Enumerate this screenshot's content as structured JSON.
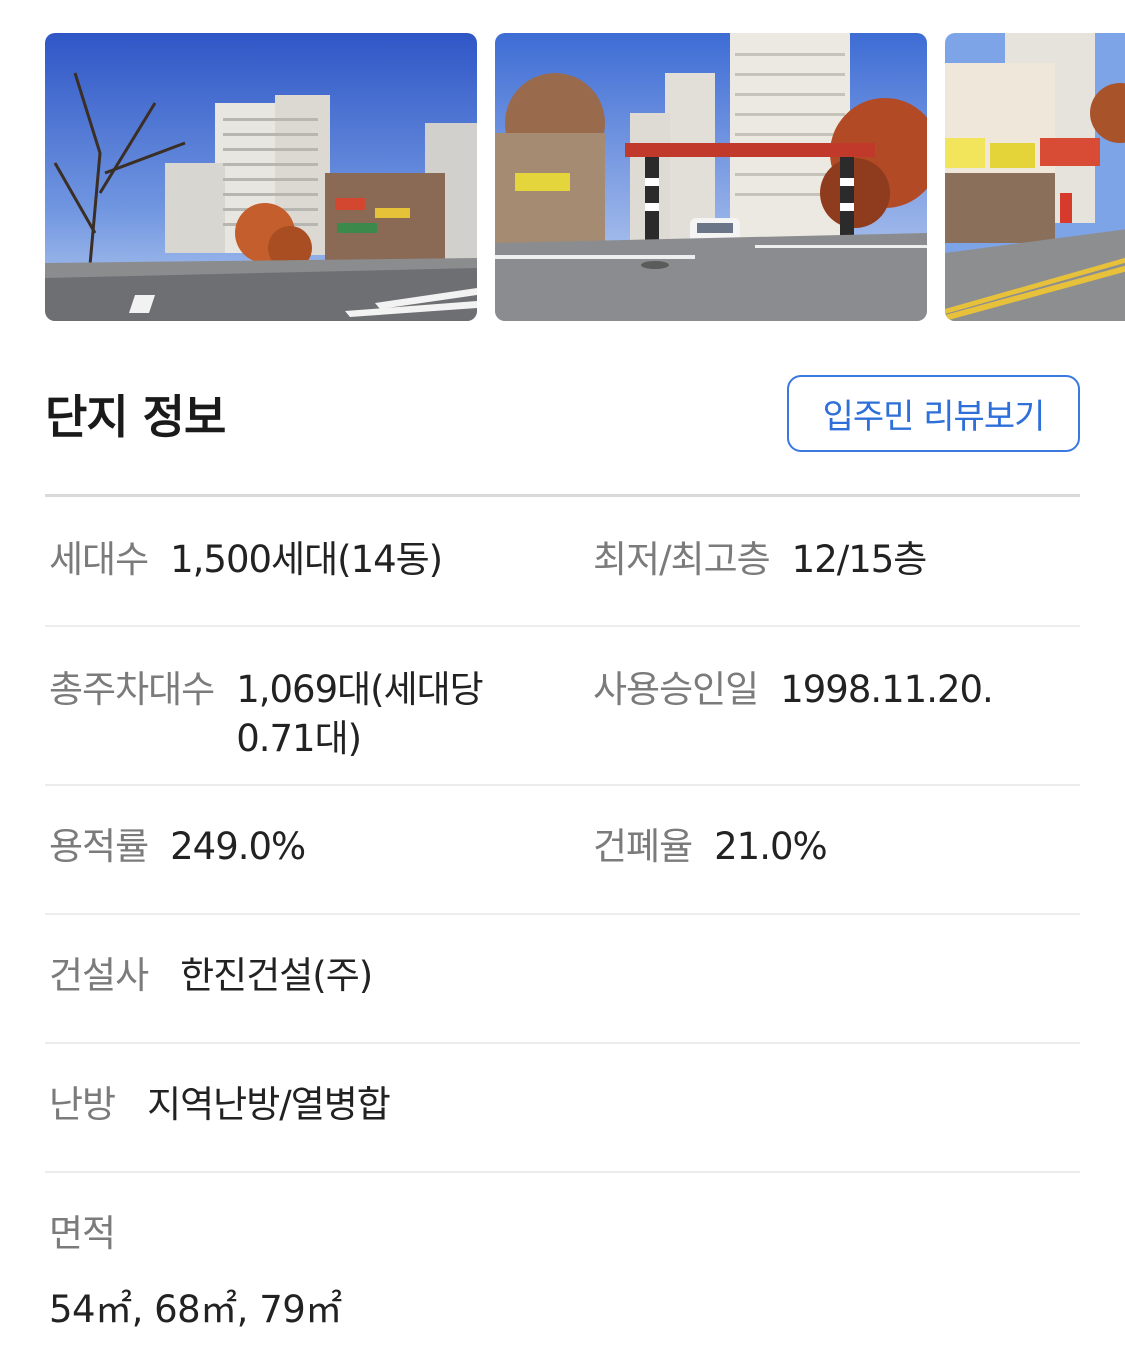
{
  "photos": [
    {
      "alt": "apartment-street-photo"
    },
    {
      "alt": "apartment-gate-photo"
    },
    {
      "alt": "shops-street-photo"
    }
  ],
  "section": {
    "title": "단지 정보",
    "review_button": "입주민 리뷰보기"
  },
  "info": {
    "households": {
      "label": "세대수",
      "value": "1,500세대(14동)"
    },
    "floors": {
      "label": "최저/최고층",
      "value": "12/15층"
    },
    "parking": {
      "label": "총주차대수",
      "value": "1,069대(세대당 0.71대)"
    },
    "approval_date": {
      "label": "사용승인일",
      "value": "1998.11.20."
    },
    "floor_area_ratio": {
      "label": "용적률",
      "value": "249.0%"
    },
    "building_coverage": {
      "label": "건폐율",
      "value": "21.0%"
    },
    "builder": {
      "label": "건설사",
      "value": "한진건설(주)"
    },
    "heating": {
      "label": "난방",
      "value": "지역난방/열병합"
    },
    "area": {
      "label": "면적",
      "value": "54㎡, 68㎡, 79㎡"
    }
  },
  "colors": {
    "accent": "#2f6fd9",
    "label": "#7b7b7b",
    "text": "#222222",
    "divider": "#ececec"
  }
}
